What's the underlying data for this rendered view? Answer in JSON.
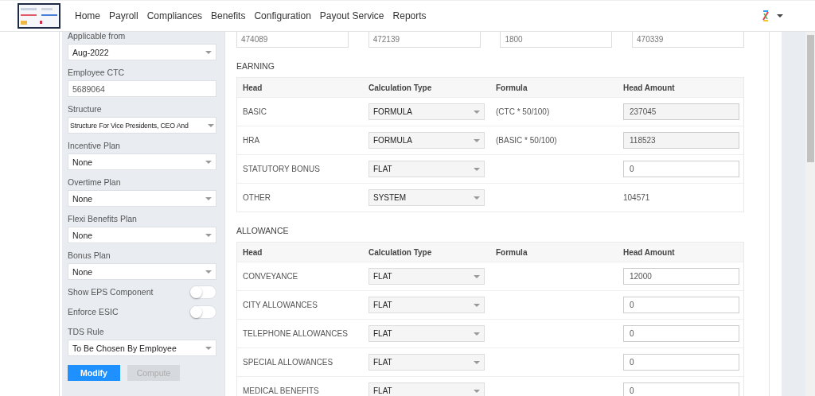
{
  "nav": {
    "items": [
      "Home",
      "Payroll",
      "Compliances",
      "Benefits",
      "Configuration",
      "Payout Service",
      "Reports"
    ]
  },
  "sidebar": {
    "fields": [
      {
        "kind": "select",
        "label": "Applicable from",
        "value": "Aug-2022"
      },
      {
        "kind": "input",
        "label": "Employee CTC",
        "value": "5689064"
      },
      {
        "kind": "select",
        "label": "Structure",
        "value": "Structure For Vice Presidents, CEO And"
      },
      {
        "kind": "select",
        "label": "Incentive Plan",
        "value": "None"
      },
      {
        "kind": "select",
        "label": "Overtime Plan",
        "value": "None"
      },
      {
        "kind": "select",
        "label": "Flexi Benefits Plan",
        "value": "None"
      },
      {
        "kind": "select",
        "label": "Bonus Plan",
        "value": "None"
      },
      {
        "kind": "toggle",
        "label": "Show EPS Component",
        "on": false
      },
      {
        "kind": "toggle",
        "label": "Enforce ESIC",
        "on": false
      },
      {
        "kind": "select",
        "label": "TDS Rule",
        "value": "To Be Chosen By Employee"
      }
    ],
    "buttons": [
      {
        "label": "Modify",
        "disabled": false
      },
      {
        "label": "Compute",
        "disabled": true
      }
    ]
  },
  "summary_fields": [
    "474089",
    "472139",
    "1800",
    "470339"
  ],
  "sections": [
    {
      "title": "EARNING",
      "columns": [
        "Head",
        "Calculation Type",
        "Formula",
        "Head Amount"
      ],
      "rows": [
        {
          "head": "BASIC",
          "calculation_type": "FORMULA",
          "formula": "(CTC * 50/100)",
          "amount": "237045",
          "kind": "readonly"
        },
        {
          "head": "HRA",
          "calculation_type": "FORMULA",
          "formula": "(BASIC * 50/100)",
          "amount": "118523",
          "kind": "readonly"
        },
        {
          "head": "STATUTORY BONUS",
          "calculation_type": "FLAT",
          "amount": "0",
          "kind": "input"
        },
        {
          "head": "OTHER",
          "calculation_type": "SYSTEM",
          "amount": "104571",
          "kind": "text"
        }
      ]
    },
    {
      "title": "ALLOWANCE",
      "columns": [
        "Head",
        "Calculation Type",
        "Formula",
        "Head Amount"
      ],
      "rows": [
        {
          "head": "CONVEYANCE",
          "calculation_type": "FLAT",
          "amount": "12000",
          "kind": "input"
        },
        {
          "head": "CITY ALLOWANCES",
          "calculation_type": "FLAT",
          "amount": "0",
          "kind": "input"
        },
        {
          "head": "TELEPHONE ALLOWANCES",
          "calculation_type": "FLAT",
          "amount": "0",
          "kind": "input"
        },
        {
          "head": "SPECIAL ALLOWANCES",
          "calculation_type": "FLAT",
          "amount": "0",
          "kind": "input"
        },
        {
          "head": "MEDICAL BENEFITS",
          "calculation_type": "FLAT",
          "amount": "0",
          "kind": "input"
        }
      ]
    }
  ]
}
